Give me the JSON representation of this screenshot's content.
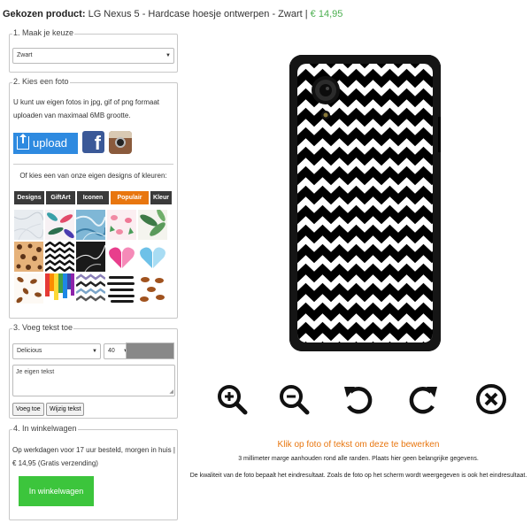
{
  "header": {
    "label": "Gekozen product:",
    "product": "LG Nexus 5 - Hardcase hoesje ontwerpen - Zwart",
    "separator": "|",
    "price": "€ 14,95"
  },
  "step1": {
    "legend": "1. Maak je keuze",
    "selected": "Zwart"
  },
  "step2": {
    "legend": "2. Kies een foto",
    "description": "U kunt uw eigen fotos in jpg, gif of png formaat uploaden van maximaal 6MB grootte.",
    "upload_label": "upload",
    "facebook_glyph": "f",
    "designs_prompt": "Of kies een van onze eigen designs of kleuren:",
    "tabs": [
      {
        "label": "Designs",
        "active": false
      },
      {
        "label": "GiftArt",
        "active": false
      },
      {
        "label": "Iconen",
        "active": false
      },
      {
        "label": "Populair",
        "active": true
      },
      {
        "label": "Kleur",
        "active": false
      }
    ],
    "thumbnails": [
      {
        "icon": "marble-white"
      },
      {
        "icon": "tropical-leaves"
      },
      {
        "icon": "blue-marble"
      },
      {
        "icon": "flamingos"
      },
      {
        "icon": "palm-leaves"
      },
      {
        "icon": "leopard-print"
      },
      {
        "icon": "chevron-black"
      },
      {
        "icon": "black-marble"
      },
      {
        "icon": "pink-hearts"
      },
      {
        "icon": "blue-heart"
      },
      {
        "icon": "coffee-beans"
      },
      {
        "icon": "paint-drips"
      },
      {
        "icon": "chevron-multicolor"
      },
      {
        "icon": "brush-stripes"
      },
      {
        "icon": "brown-lips"
      }
    ]
  },
  "step3": {
    "legend": "3. Voeg tekst toe",
    "font": "Delicious",
    "size": "40",
    "text_color": "#888888",
    "placeholder": "Je eigen tekst",
    "add_button": "Voeg toe",
    "edit_button": "Wijzig tekst"
  },
  "step4": {
    "legend": "4. In winkelwagen",
    "description": "Op werkdagen voor 17 uur besteld, morgen in huis | € 14,95 (Gratis verzending)",
    "cart_button": "In winkelwagen"
  },
  "preview": {
    "design": "chevron-black",
    "controls": [
      "zoom-in-icon",
      "zoom-out-icon",
      "rotate-left-icon",
      "rotate-right-icon",
      "remove-icon"
    ],
    "instruction_main": "Klik op foto of tekst om deze te bewerken",
    "instruction_margin": "3 millimeter marge aanhouden rond alle randen. Plaats hier geen belangrijke gegevens.",
    "instruction_quality": "De kwaliteit van de foto bepaalt het eindresultaat. Zoals de foto op het scherm wordt weergegeven is ook het eindresultaat."
  },
  "colors": {
    "accent_orange": "#e8760f",
    "price_green": "#4caf50",
    "upload_blue": "#2e8ae0",
    "cart_green": "#3cc53c"
  }
}
